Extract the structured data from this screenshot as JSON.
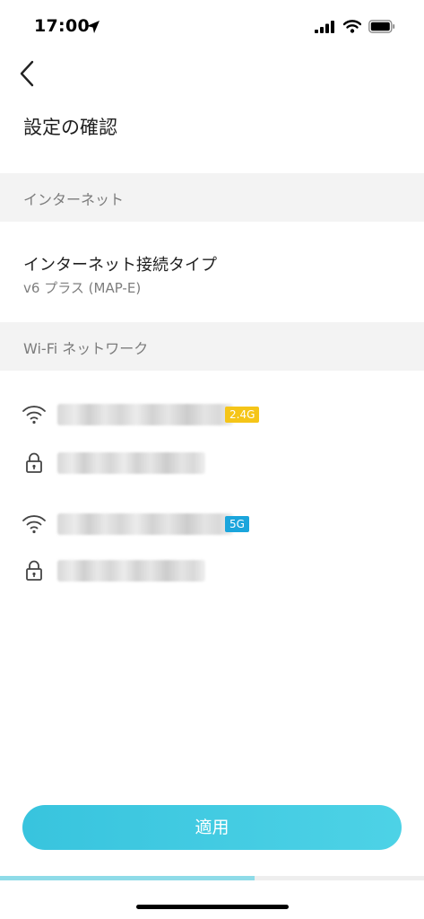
{
  "status_bar": {
    "time": "17:00"
  },
  "header": {
    "title": "設定の確認"
  },
  "internet_section": {
    "header": "インターネット",
    "connection_type_label": "インターネット接続タイプ",
    "connection_type_value": "v6 プラス (MAP-E)"
  },
  "wifi_section": {
    "header": "Wi-Fi ネットワーク",
    "networks": [
      {
        "band": "2.4G",
        "band_color": "#f5c518",
        "ssid_hidden": true,
        "password_hidden": true
      },
      {
        "band": "5G",
        "band_color": "#1ba5dc",
        "ssid_hidden": true,
        "password_hidden": true
      }
    ]
  },
  "footer": {
    "apply_label": "適用",
    "progress_fraction": 0.6,
    "accent": "#3fc8e0"
  },
  "icons": [
    "location-arrow-icon",
    "cellular-signal-icon",
    "wifi-status-icon",
    "battery-icon",
    "back-chevron-icon",
    "wifi-icon",
    "lock-icon"
  ]
}
